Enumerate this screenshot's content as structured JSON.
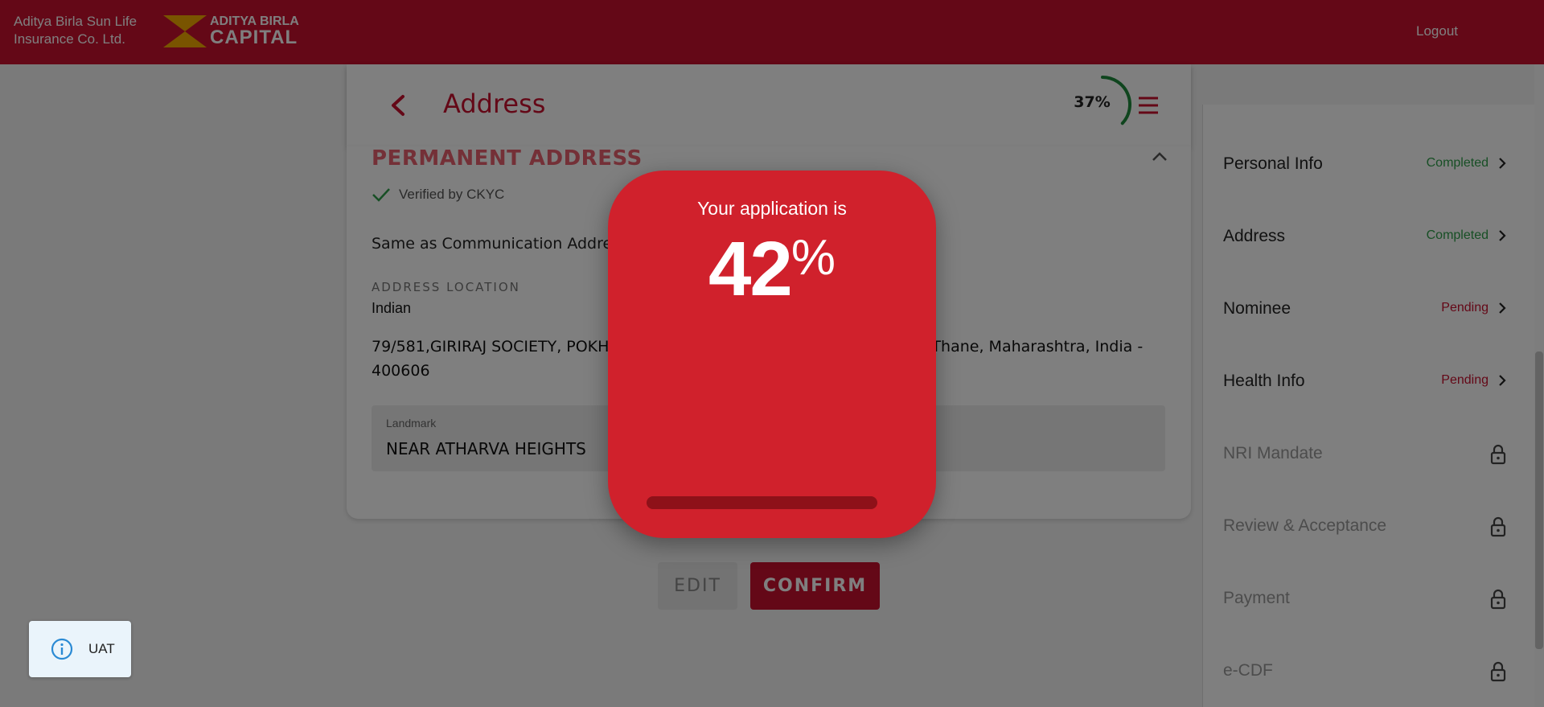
{
  "header": {
    "brand_line1": "Aditya Birla Sun Life",
    "brand_line2": "Insurance Co. Ltd.",
    "logo_line1": "ADITYA BIRLA",
    "logo_line2": "CAPITAL",
    "logout_label": "Logout"
  },
  "page": {
    "title": "Address",
    "progress_text": "37%",
    "progress_value": 37
  },
  "address_section": {
    "title": "PERMANENT ADDRESS",
    "verified_text": "Verified by CKYC",
    "same_as_text": "Same as Communication Address",
    "location_label": "ADDRESS LOCATION",
    "location_value": "Indian",
    "address_text": "79/581,GIRIRAJ SOCIETY, POKHRAN ROAD NO. 2, VARTAK NAGAR, Thane, Thane, Maharashtra, India - 400606",
    "landmark_label": "Landmark",
    "landmark_value": "NEAR ATHARVA HEIGHTS"
  },
  "actions": {
    "edit_label": "EDIT",
    "confirm_label": "CONFIRM"
  },
  "sidebar": {
    "items": [
      {
        "label": "Personal Info",
        "status": "Completed"
      },
      {
        "label": "Address",
        "status": "Completed"
      },
      {
        "label": "Nominee",
        "status": "Pending"
      },
      {
        "label": "Health Info",
        "status": "Pending"
      },
      {
        "label": "NRI Mandate",
        "status": ""
      },
      {
        "label": "Review & Acceptance",
        "status": ""
      },
      {
        "label": "Payment",
        "status": ""
      },
      {
        "label": "e-CDF",
        "status": ""
      }
    ]
  },
  "popup": {
    "caption": "Your application is",
    "value": "42",
    "unit": "%",
    "progress_value": 42
  },
  "env_badge": {
    "label": "UAT",
    "icon": "info-icon"
  },
  "colors": {
    "brand_red": "#c8102e",
    "completed_green": "#2e9e4a",
    "popup_red": "#d0212c"
  }
}
